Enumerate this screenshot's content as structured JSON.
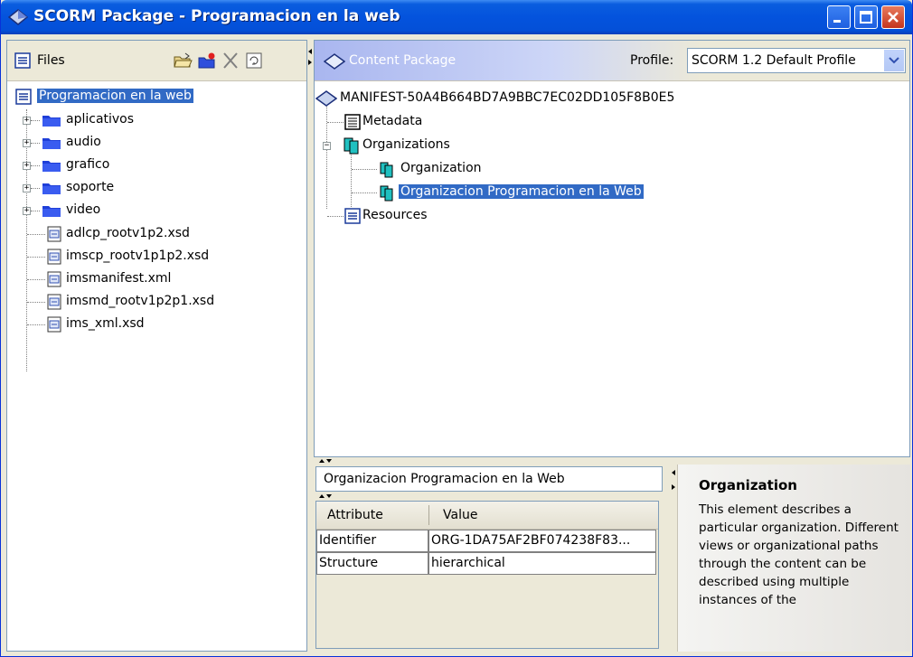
{
  "window": {
    "title": "SCORM Package - Programacion en la web"
  },
  "files_panel": {
    "label": "Files",
    "root": "Programacion en la web",
    "folders": [
      "aplicativos",
      "audio",
      "grafico",
      "soporte",
      "video"
    ],
    "files": [
      "adlcp_rootv1p2.xsd",
      "imscp_rootv1p1p2.xsd",
      "imsmanifest.xml",
      "imsmd_rootv1p2p1.xsd",
      "ims_xml.xsd"
    ]
  },
  "content_panel": {
    "label": "Content Package",
    "profile_label": "Profile:",
    "profile_value": "SCORM 1.2 Default Profile",
    "manifest": "MANIFEST-50A4B664BD7A9BBC7EC02DD105F8B0E5",
    "metadata": "Metadata",
    "organizations": "Organizations",
    "organization": "Organization",
    "organization_selected": "Organizacion Programacion en la Web",
    "resources": "Resources"
  },
  "properties": {
    "title_value": "Organizacion Programacion en la Web",
    "col_attribute": "Attribute",
    "col_value": "Value",
    "rows": [
      {
        "attribute": "Identifier",
        "value": "ORG-1DA75AF2BF074238F83..."
      },
      {
        "attribute": "Structure",
        "value": "hierarchical"
      }
    ]
  },
  "help": {
    "title": "Organization",
    "text": "This element describes a particular organization. Different views or organizational paths through the content can be described using multiple instances of the"
  },
  "colors": {
    "title_bar": "#0453dd",
    "selection": "#316ac5",
    "folder": "#1f3fd8",
    "org_icon": "#20c0c0"
  }
}
